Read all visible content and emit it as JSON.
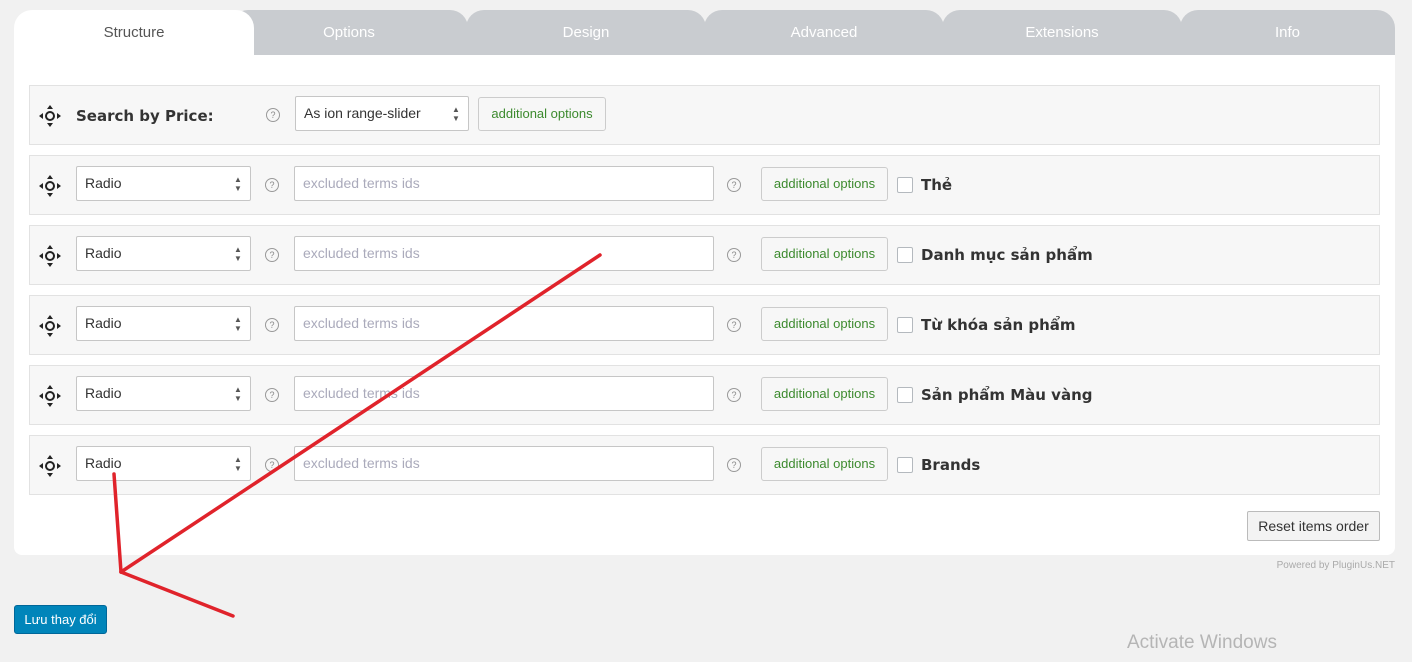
{
  "tabs": [
    "Structure",
    "Options",
    "Design",
    "Advanced",
    "Extensions",
    "Info"
  ],
  "price_row": {
    "label": "Search by Price:",
    "select_value": "As ion range-slider",
    "additional_options": "additional options"
  },
  "filter_rows": [
    {
      "select_value": "Radio",
      "placeholder": "excluded terms ids",
      "additional_options": "additional options",
      "label": "Thẻ"
    },
    {
      "select_value": "Radio",
      "placeholder": "excluded terms ids",
      "additional_options": "additional options",
      "label": "Danh mục sản phẩm"
    },
    {
      "select_value": "Radio",
      "placeholder": "excluded terms ids",
      "additional_options": "additional options",
      "label": "Từ khóa sản phẩm"
    },
    {
      "select_value": "Radio",
      "placeholder": "excluded terms ids",
      "additional_options": "additional options",
      "label": "Sản phẩm Màu vàng"
    },
    {
      "select_value": "Radio",
      "placeholder": "excluded terms ids",
      "additional_options": "additional options",
      "label": "Brands"
    }
  ],
  "help_glyph": "?",
  "reset_button": "Reset items order",
  "powered_by": "Powered by PluginUs.NET",
  "save_button": "Lưu thay đổi",
  "watermark": "Activate Windows",
  "colors": {
    "accent": "#0085ba",
    "annotation": "#e0232b",
    "tab_inactive": "#c9ccd0"
  }
}
